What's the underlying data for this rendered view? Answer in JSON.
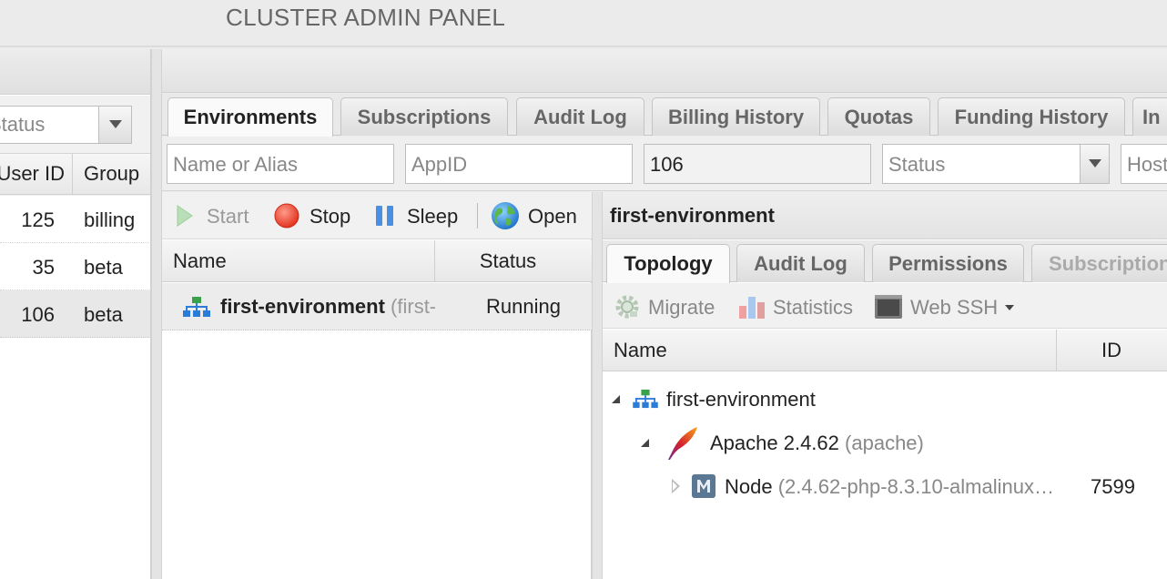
{
  "app": {
    "title": "CLUSTER ADMIN PANEL"
  },
  "left_panel": {
    "filter_select": {
      "value": "Status"
    },
    "columns": {
      "user_id": "User ID",
      "group": "Group"
    },
    "rows": [
      {
        "user_id": "125",
        "group": "billing"
      },
      {
        "user_id": "35",
        "group": "beta"
      },
      {
        "user_id": "106",
        "group": "beta",
        "selected": true
      }
    ]
  },
  "tabs": [
    {
      "label": "Environments",
      "active": true
    },
    {
      "label": "Subscriptions"
    },
    {
      "label": "Audit Log"
    },
    {
      "label": "Billing History"
    },
    {
      "label": "Quotas"
    },
    {
      "label": "Funding History"
    },
    {
      "label": "In"
    }
  ],
  "filters": {
    "name_placeholder": "Name or Alias",
    "appid_placeholder": "AppID",
    "user_value": "106",
    "status_placeholder": "Status",
    "host_placeholder": "Host"
  },
  "env_toolbar": {
    "start": "Start",
    "stop": "Stop",
    "sleep": "Sleep",
    "open": "Open"
  },
  "env_table": {
    "columns": {
      "name": "Name",
      "status": "Status"
    },
    "rows": [
      {
        "name": "first-environment",
        "alias": "(first-environment)",
        "status": "Running"
      }
    ]
  },
  "detail": {
    "title": "first-environment",
    "tabs": [
      {
        "label": "Topology",
        "active": true
      },
      {
        "label": "Audit Log"
      },
      {
        "label": "Permissions"
      },
      {
        "label": "Subscriptions",
        "disabled": true
      }
    ],
    "toolbar": {
      "migrate": "Migrate",
      "statistics": "Statistics",
      "web_ssh": "Web SSH"
    },
    "columns": {
      "name": "Name",
      "id": "ID"
    },
    "tree": {
      "env": "first-environment",
      "server": "Apache 2.4.62",
      "server_alias": "(apache)",
      "node": "Node",
      "node_detail": "(2.4.62-php-8.3.10-almalinux…",
      "node_id": "7599"
    }
  },
  "colors": {
    "accent_green": "#3aa24a",
    "accent_blue": "#2b7bd8",
    "stop_red": "#e74c3c"
  }
}
